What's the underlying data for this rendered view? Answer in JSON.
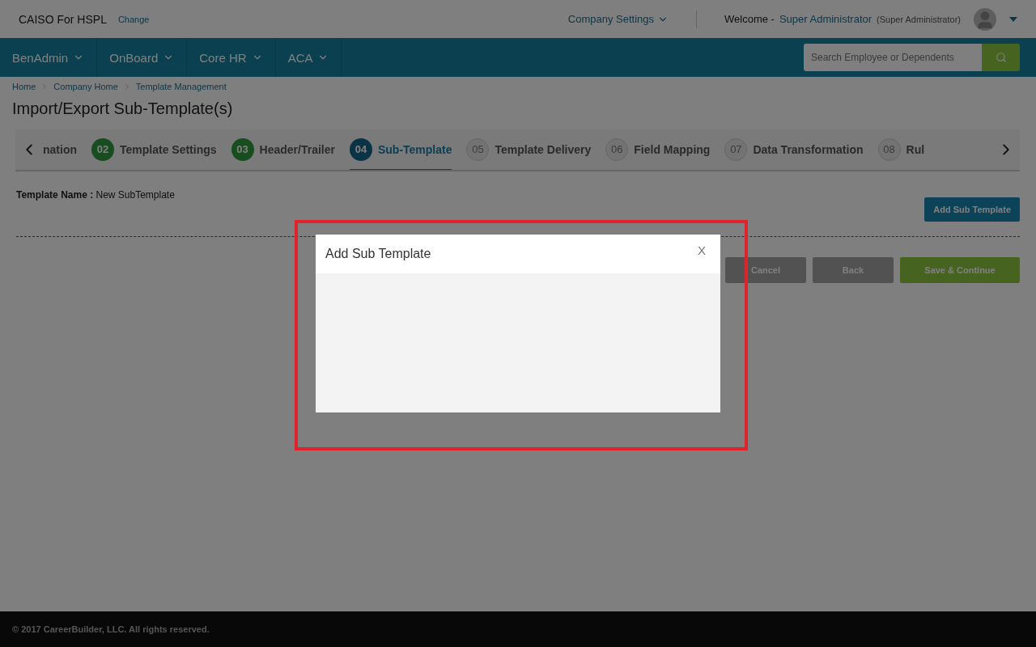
{
  "header": {
    "company": "CAISO For HSPL",
    "change_link": "Change",
    "company_settings": "Company Settings",
    "welcome": "Welcome -",
    "user_name": "Super Administrator",
    "user_role": "(Super Administrator)"
  },
  "nav": {
    "items": [
      {
        "label": "BenAdmin"
      },
      {
        "label": "OnBoard"
      },
      {
        "label": "Core HR"
      },
      {
        "label": "ACA"
      }
    ],
    "search": {
      "placeholder": "Search Employee or Dependents"
    }
  },
  "breadcrumb": [
    "Home",
    "Company Home",
    "Template Management"
  ],
  "page_title": "Import/Export Sub-Template(s)",
  "steps": [
    {
      "label": "nation",
      "selected": false
    },
    {
      "number": "02",
      "label": "Template Settings",
      "kind": "done",
      "selected": false
    },
    {
      "number": "03",
      "label": "Header/Trailer",
      "kind": "done",
      "selected": false
    },
    {
      "number": "04",
      "label": "Sub-Template",
      "kind": "current",
      "selected": true
    },
    {
      "number": "05",
      "label": "Template Delivery",
      "kind": "todo",
      "selected": false
    },
    {
      "number": "06",
      "label": "Field Mapping",
      "kind": "todo",
      "selected": false
    },
    {
      "number": "07",
      "label": "Data Transformation",
      "kind": "todo",
      "selected": false
    },
    {
      "number": "08",
      "label": "Rul",
      "kind": "todo",
      "selected": false
    }
  ],
  "template_name": {
    "label": "Template Name :",
    "value": "New SubTemplate"
  },
  "add_button": "Add Sub Template",
  "actions": [
    {
      "label": "Cancel",
      "kind": "secondary"
    },
    {
      "label": "Back",
      "kind": "secondary"
    },
    {
      "label": "Save & Continue",
      "kind": "primary"
    }
  ],
  "modal": {
    "title": "Add Sub Template",
    "close": "X"
  },
  "footer": "© 2017 CareerBuilder, LLC. All rights reserved."
}
